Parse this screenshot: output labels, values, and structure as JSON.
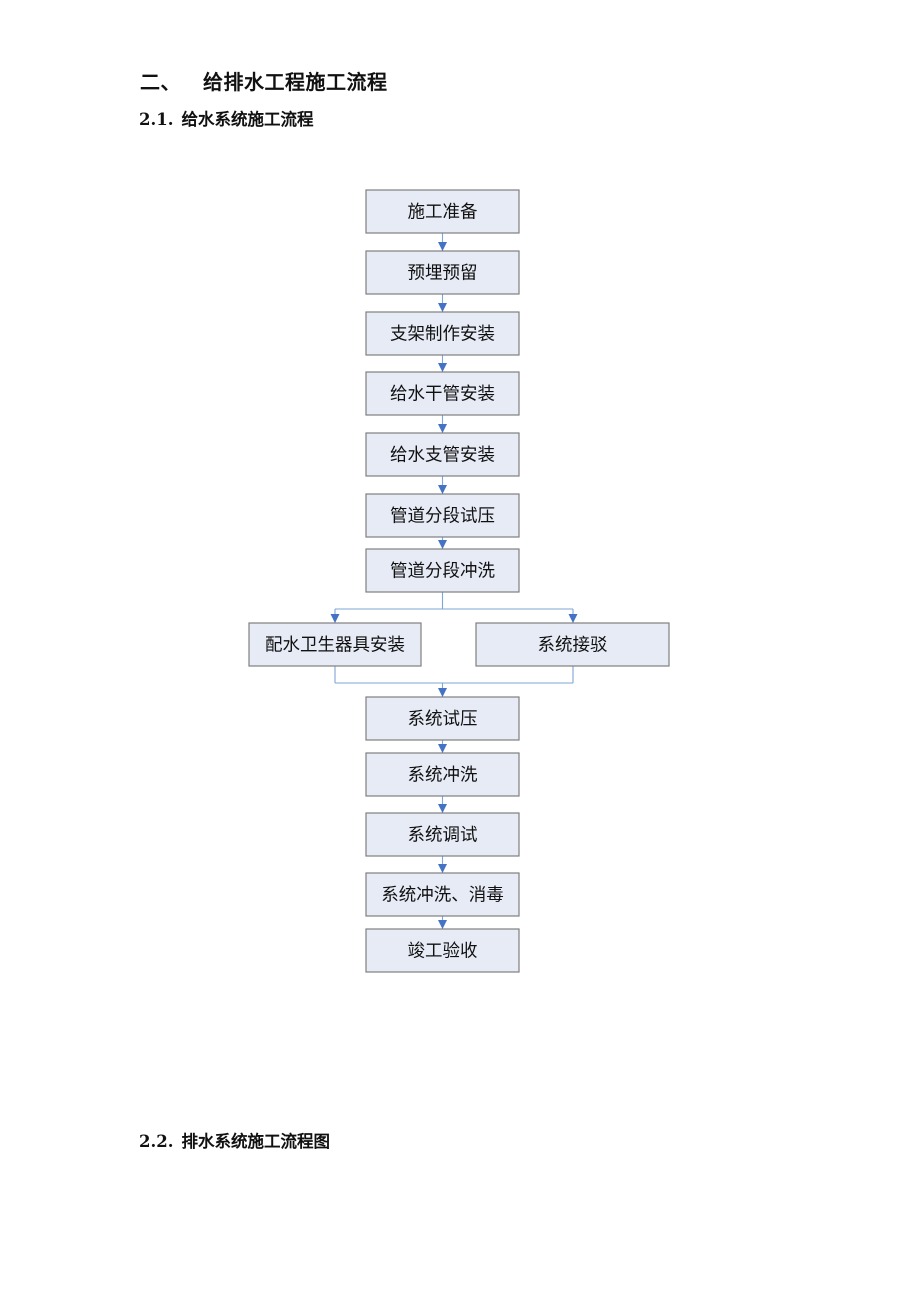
{
  "document": {
    "section_heading": {
      "number": "二、",
      "title": "给排水工程施工流程"
    },
    "subsection_water_supply": {
      "number": "2.1.",
      "title": "给水系统施工流程"
    },
    "subsection_drainage": {
      "number": "2.2.",
      "title": "排水系统施工流程图"
    }
  },
  "flowchart": {
    "title": "给水系统施工流程",
    "colors": {
      "node_fill": "#e6ebf6",
      "node_border": "#7f7f7f",
      "connector": "#7ea6d6",
      "arrowhead": "#4472c4"
    },
    "steps_before_branch": [
      "施工准备",
      "预埋预留",
      "支架制作安装",
      "给水干管安装",
      "给水支管安装",
      "管道分段试压",
      "管道分段冲洗"
    ],
    "parallel_steps": [
      "配水卫生器具安装",
      "系统接驳"
    ],
    "steps_after_merge": [
      "系统试压",
      "系统冲洗",
      "系统调试",
      "系统冲洗、消毒",
      "竣工验收"
    ]
  }
}
